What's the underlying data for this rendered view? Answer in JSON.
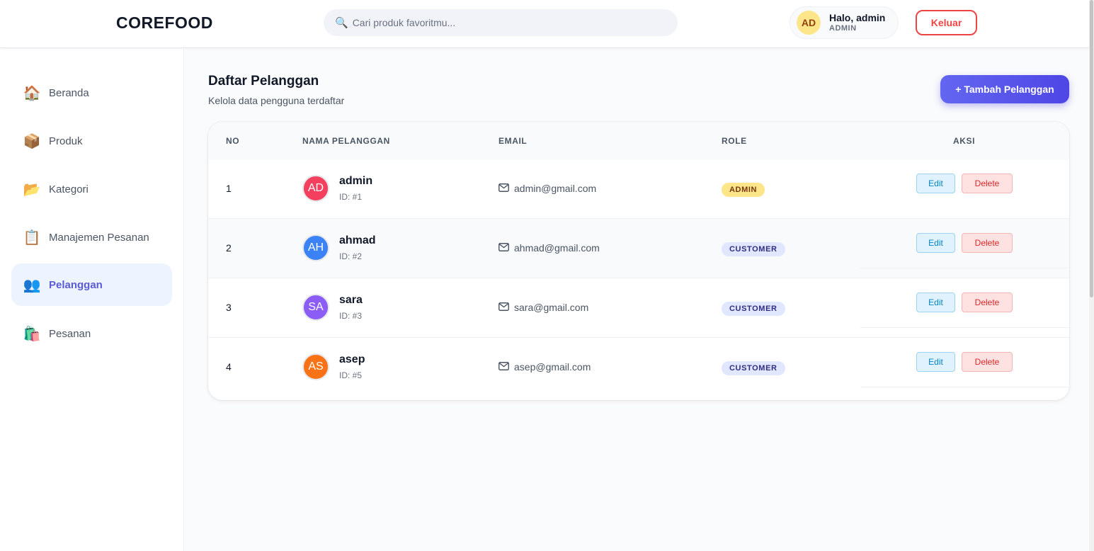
{
  "header": {
    "brand": "COREFOOD",
    "search_placeholder": "Cari produk favoritmu...",
    "search_icon": "🔍",
    "user_initials": "AD",
    "user_greeting": "Halo, admin",
    "user_role": "ADMIN",
    "logout_label": "Keluar"
  },
  "sidebar": {
    "items": [
      {
        "icon": "🏠",
        "icon_name": "home-icon",
        "label": "Beranda"
      },
      {
        "icon": "📦",
        "icon_name": "package-icon",
        "label": "Produk"
      },
      {
        "icon": "📂",
        "icon_name": "folder-icon",
        "label": "Kategori"
      },
      {
        "icon": "📋",
        "icon_name": "clipboard-icon",
        "label": "Manajemen Pesanan"
      },
      {
        "icon": "👥",
        "icon_name": "users-icon",
        "label": "Pelanggan",
        "active": true
      },
      {
        "icon": "🛍️",
        "icon_name": "shopping-bags-icon",
        "label": "Pesanan"
      }
    ]
  },
  "main": {
    "title": "Daftar Pelanggan",
    "subtitle": "Kelola data pengguna terdaftar",
    "add_button": "+ Tambah Pelanggan",
    "table": {
      "headers": [
        "NO",
        "NAMA PELANGGAN",
        "EMAIL",
        "ROLE",
        "AKSI"
      ],
      "rows": [
        {
          "no": "1",
          "initials": "AD",
          "avatar_color": "#f43f5e",
          "name": "admin",
          "id": "ID: #1",
          "email": "admin@gmail.com",
          "role": "ADMIN",
          "role_type": "admin",
          "edit": "Edit",
          "delete": "Delete"
        },
        {
          "no": "2",
          "initials": "AH",
          "avatar_color": "#3b82f6",
          "name": "ahmad",
          "id": "ID: #2",
          "email": "ahmad@gmail.com",
          "role": "CUSTOMER",
          "role_type": "customer",
          "edit": "Edit",
          "delete": "Delete"
        },
        {
          "no": "3",
          "initials": "SA",
          "avatar_color": "#8b5cf6",
          "name": "sara",
          "id": "ID: #3",
          "email": "sara@gmail.com",
          "role": "CUSTOMER",
          "role_type": "customer",
          "edit": "Edit",
          "delete": "Delete"
        },
        {
          "no": "4",
          "initials": "AS",
          "avatar_color": "#f97316",
          "name": "asep",
          "id": "ID: #5",
          "email": "asep@gmail.com",
          "role": "CUSTOMER",
          "role_type": "customer",
          "edit": "Edit",
          "delete": "Delete"
        }
      ]
    }
  }
}
